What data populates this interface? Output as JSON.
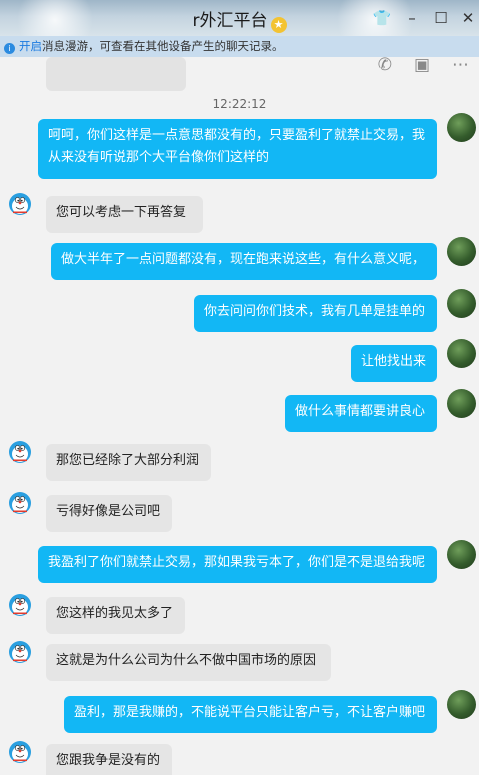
{
  "window": {
    "title": "r外汇平台",
    "badge_icon": "crown-icon",
    "controls": [
      "shirt-icon",
      "minimize-icon",
      "maximize-icon",
      "close-icon"
    ]
  },
  "notice": {
    "link": "开启",
    "text": "消息漫游，可查看在其他设备产生的聊天记录。"
  },
  "chat": {
    "timestamp": "12:22:12",
    "messages": [
      {
        "side": "out",
        "lines": [
          "呵呵，你们这样是一点意思都没有的，只要盈利了就禁止交易，我",
          "从来没有听说那个大平台像你们这样的"
        ]
      },
      {
        "side": "in",
        "lines": [
          "您可以考虑一下再答复"
        ]
      },
      {
        "side": "out",
        "lines": [
          "做大半年了一点问题都没有，现在跑来说这些，有什么意义呢，"
        ]
      },
      {
        "side": "out",
        "lines": [
          "你去问问你们技术，我有几单是挂单的"
        ]
      },
      {
        "side": "out",
        "lines": [
          "让他找出来"
        ]
      },
      {
        "side": "out",
        "lines": [
          "做什么事情都要讲良心"
        ]
      },
      {
        "side": "in",
        "lines": [
          "那您已经除了大部分利润"
        ]
      },
      {
        "side": "in",
        "lines": [
          "亏得好像是公司吧"
        ]
      },
      {
        "side": "out",
        "lines": [
          "我盈利了你们就禁止交易，那如果我亏本了，你们是不是退给我呢"
        ]
      },
      {
        "side": "in",
        "lines": [
          "您这样的我见太多了"
        ]
      },
      {
        "side": "in",
        "lines": [
          "这就是为什么公司为什么不做中国市场的原因"
        ]
      },
      {
        "side": "out",
        "lines": [
          "盈利，那是我赚的，不能说平台只能让客户亏，不让客户赚吧"
        ]
      },
      {
        "side": "in",
        "lines": [
          "您跟我争是没有的"
        ]
      }
    ]
  },
  "colors": {
    "outgoing_bubble": "#12b7f5",
    "incoming_bubble": "#e5e5e5",
    "notice_bg": "#c8dcee",
    "link": "#1d7be0"
  }
}
